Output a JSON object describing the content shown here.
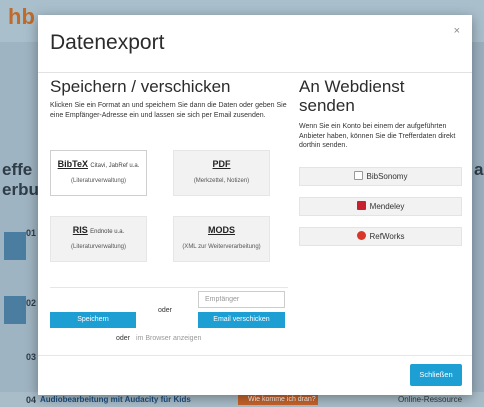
{
  "modal": {
    "title": "Datenexport",
    "close": "×",
    "left": {
      "heading": "Speichern / verschicken",
      "description": "Klicken Sie ein Format an und speichern Sie dann die Daten oder geben Sie eine Empfänger-Adresse ein und lassen sie sich per Email zusenden.",
      "formats": [
        {
          "name": "BibTeX",
          "extra": "Citavi, JabRef u.a.",
          "sub": "(Literaturverwaltung)"
        },
        {
          "name": "PDF",
          "extra": "",
          "sub": "(Merkzettel, Notizen)"
        },
        {
          "name": "RIS",
          "extra": "Endnote u.a.",
          "sub": "(Literaturverwaltung)"
        },
        {
          "name": "MODS",
          "extra": "",
          "sub": "(XML zur Weiterverarbeitung)"
        }
      ],
      "recipient_placeholder": "Empfänger",
      "save_label": "Speichern",
      "or_label": "oder",
      "email_label": "Email verschicken",
      "or_label_2": "oder",
      "browser_label": "im Browser anzeigen"
    },
    "right": {
      "heading": "An Webdienst senden",
      "description": "Wenn Sie ein Konto bei einem der aufgeführten Anbieter haben, können Sie die Trefferdaten direkt dorthin senden.",
      "services": [
        {
          "label": "BibSonomy",
          "icon": "bibsonomy-icon",
          "color": "#9a9a9a"
        },
        {
          "label": "Mendeley",
          "icon": "mendeley-icon",
          "color": "#c8202f"
        },
        {
          "label": "RefWorks",
          "icon": "refworks-icon",
          "color": "#d9362a"
        }
      ]
    },
    "footer": {
      "close_label": "Schließen"
    }
  },
  "background": {
    "logo": "hb",
    "big_left_1": "effe",
    "big_left_2": "erbu",
    "big_right": "al",
    "numbers": [
      "01",
      "02",
      "03",
      "04"
    ],
    "bottom_title": "Audiobearbeitung mit Audacity für Kids",
    "bottom_badge": "Wie komme ich dran?",
    "bottom_tail": "Online-Ressource"
  },
  "colors": {
    "accent": "#1e9fd4",
    "overlay": "#8fa7b6"
  }
}
